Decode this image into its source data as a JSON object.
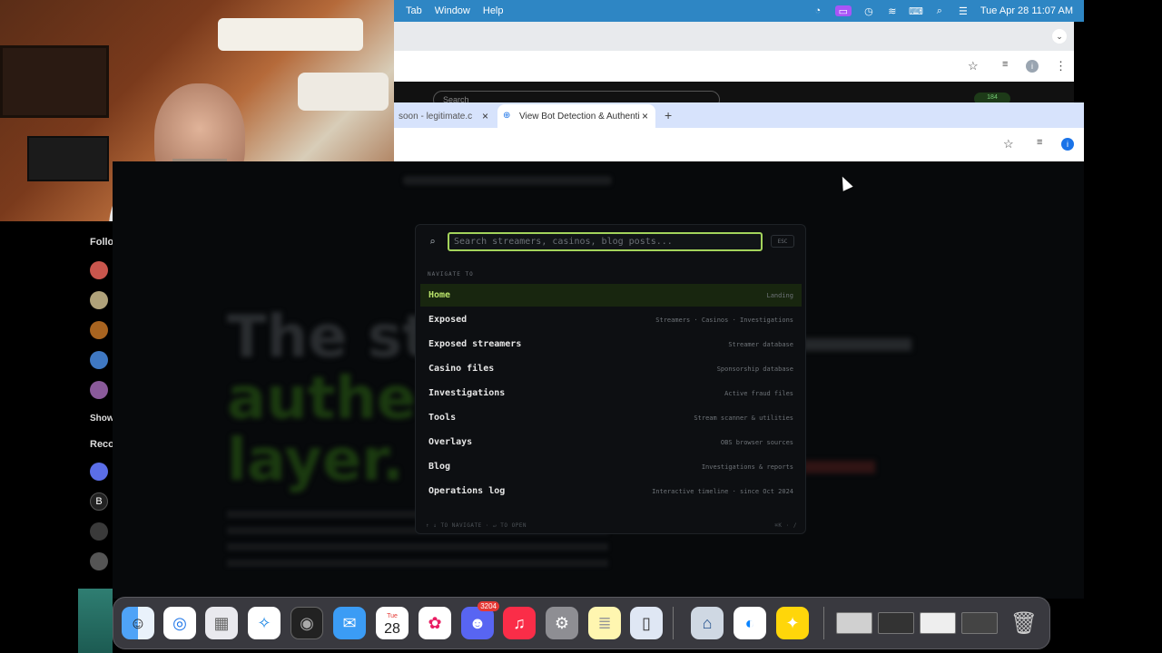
{
  "menubar": {
    "items": [
      "Tab",
      "Window",
      "Help"
    ],
    "datetime": "Tue Apr 28  11:07 AM"
  },
  "followers": {
    "heading": "Follo",
    "show": "Show",
    "recommended": "Reco"
  },
  "browser2": {
    "tabs": [
      {
        "title": "soon - legitimate.c",
        "active": false
      },
      {
        "title": "View Bot Detection & Authenti",
        "active": true
      }
    ],
    "new_tab": "+"
  },
  "peek": {
    "search": "Search",
    "badge": "184"
  },
  "palette": {
    "placeholder": "Search streamers, casinos, blog posts...",
    "esc": "ESC",
    "section": "NAVIGATE TO",
    "items": [
      {
        "name": "Home",
        "desc": "Landing",
        "selected": true
      },
      {
        "name": "Exposed",
        "desc": "Streamers · Casinos · Investigations"
      },
      {
        "name": "Exposed streamers",
        "desc": "Streamer database"
      },
      {
        "name": "Casino files",
        "desc": "Sponsorship database"
      },
      {
        "name": "Investigations",
        "desc": "Active fraud files"
      },
      {
        "name": "Tools",
        "desc": "Stream scanner & utilities"
      },
      {
        "name": "Overlays",
        "desc": "OBS browser sources"
      },
      {
        "name": "Blog",
        "desc": "Investigations & reports"
      },
      {
        "name": "Operations log",
        "desc": "Interactive timeline · since Oct 2024"
      }
    ],
    "footer_left": "↑ ↓ TO NAVIGATE · ↵ TO OPEN",
    "footer_right": "⌘K · /"
  },
  "hero": {
    "line1": "The streaming",
    "line2": "authenticity",
    "line3": "layer."
  },
  "dock": {
    "calendar_month": "Tue",
    "calendar_day": "28",
    "discord_badge": "3204"
  }
}
